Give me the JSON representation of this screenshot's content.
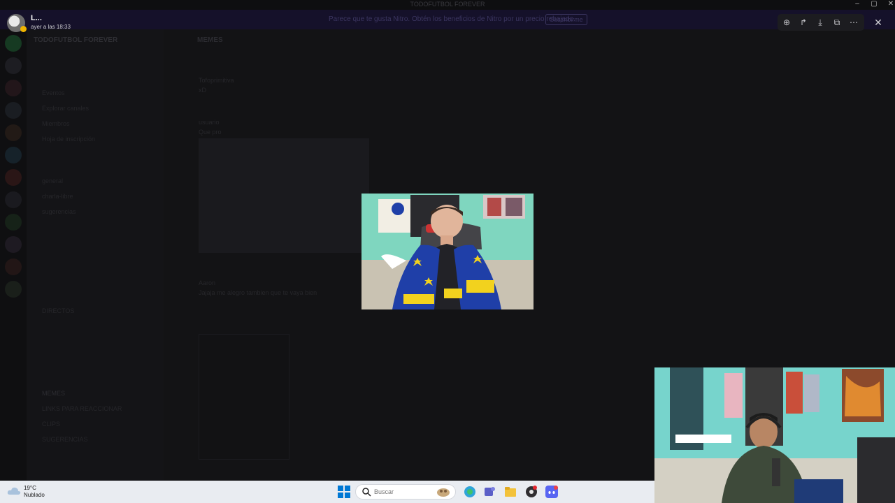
{
  "window": {
    "title": "TODOFUTBOL FOREVER",
    "controls": [
      "–",
      "▢",
      "✕"
    ]
  },
  "notice": {
    "text": "Parece que te gusta Nitro. Obtén los beneficios de Nitro por un precio rebajado.",
    "button": "Suscribirme"
  },
  "server": {
    "name": "TODOFUTBOL FOREVER",
    "channels": [
      "Eventos",
      "Explorar canales",
      "Miembros",
      "Hoja de inscripción",
      "general",
      "charla-libre",
      "sugerencias",
      "DIRECTOS",
      "MEMES",
      "LINKS PARA REACCIONAR",
      "CLIPS",
      "SUGERENCIAS"
    ]
  },
  "chat": {
    "channel": "MEMES",
    "messages": [
      {
        "author": "Tofoprimitiva",
        "text": "xD"
      },
      {
        "author": "usuario",
        "text": "Que pro"
      },
      {
        "author": "Aaron",
        "text": "Jajaja me alegro tambien que te vaya bien"
      }
    ]
  },
  "viewer": {
    "user_name": "L...",
    "user_time": "ayer a las 18:33",
    "tools": [
      {
        "icon": "zoom-icon",
        "glyph": "⊕"
      },
      {
        "icon": "forward-icon",
        "glyph": "↱"
      },
      {
        "icon": "download-icon",
        "glyph": "⤓"
      },
      {
        "icon": "open-external-icon",
        "glyph": "⧉"
      },
      {
        "icon": "more-icon",
        "glyph": "⋯"
      }
    ],
    "close_glyph": "✕"
  },
  "taskbar": {
    "weather_temp": "19°C",
    "weather_desc": "Nublado",
    "search_placeholder": "Buscar",
    "apps": [
      "edge-copilot-icon",
      "teams-icon",
      "file-explorer-icon",
      "obs-icon",
      "discord-icon"
    ]
  },
  "colors": {
    "accent": "#5865f2",
    "windows_blue": "#0078d4",
    "boca_blue": "#1f3fa8",
    "boca_yellow": "#f2d21e"
  }
}
